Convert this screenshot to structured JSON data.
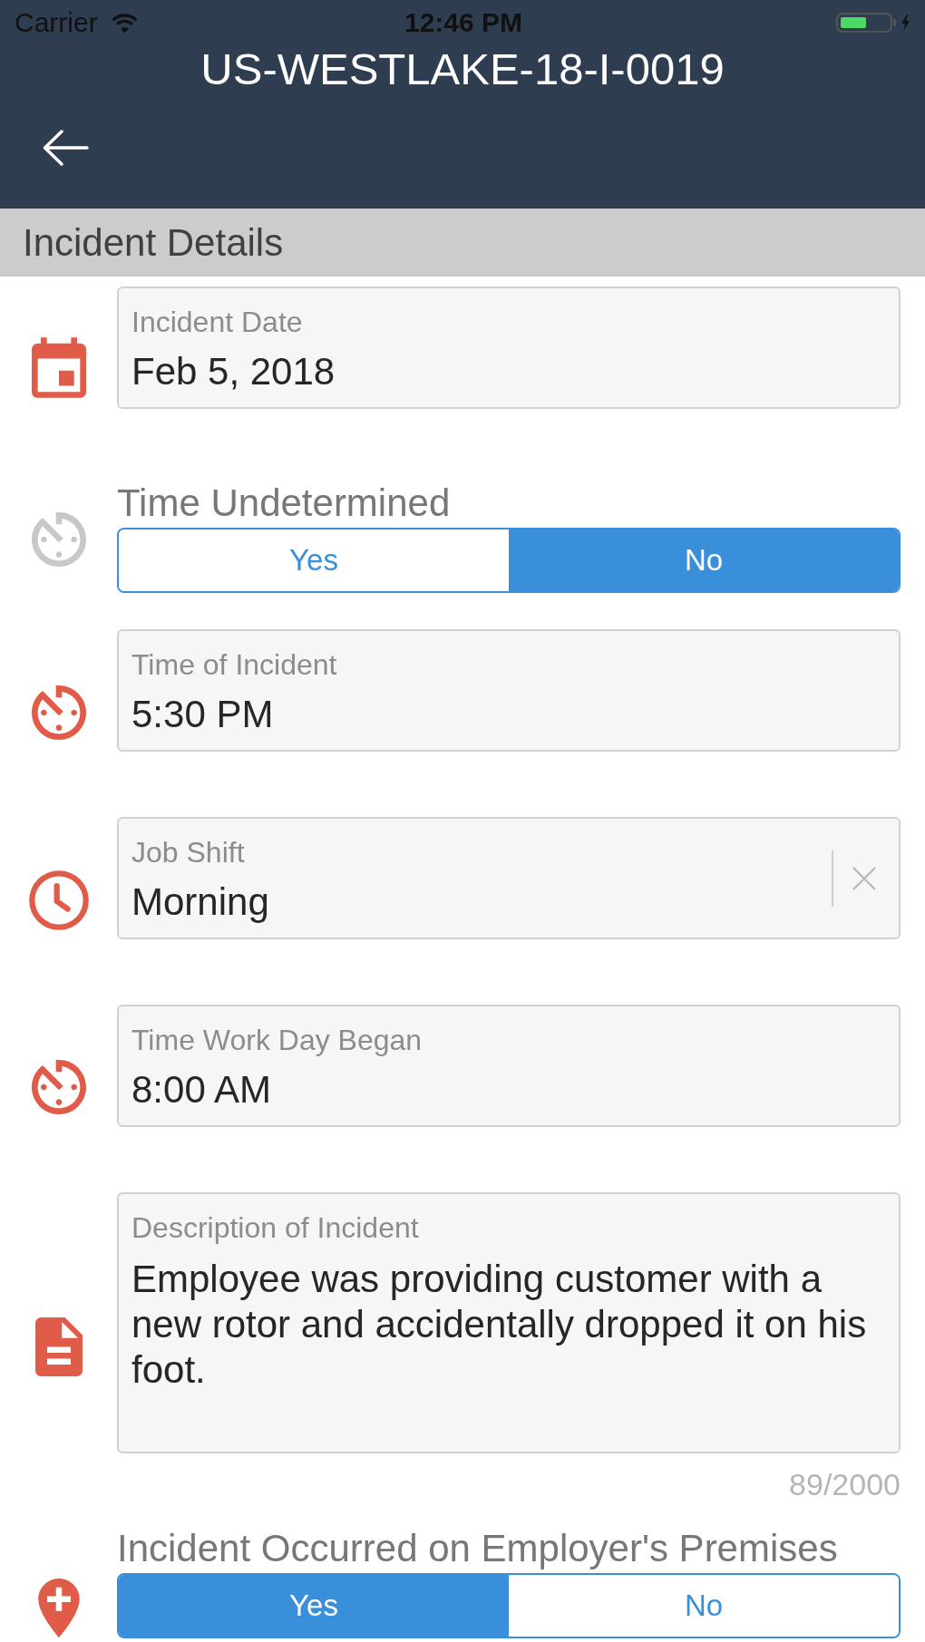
{
  "status_bar": {
    "carrier": "Carrier",
    "time": "12:46 PM"
  },
  "header": {
    "title": "US-WESTLAKE-18-I-0019"
  },
  "section": {
    "title": "Incident Details",
    "rows": [
      {
        "kind": "field",
        "color": "#e05c48",
        "label": "Incident Date",
        "value": "Feb 5, 2018",
        "clearable": false
      },
      {
        "kind": "toggle",
        "color": "#c8c8c8",
        "label": "Time Undetermined",
        "options": [
          {
            "label": "Yes",
            "selected": false
          },
          {
            "label": "No",
            "selected": true
          }
        ]
      },
      {
        "kind": "field",
        "color": "#e05c48",
        "label": "Time of Incident",
        "value": "5:30 PM",
        "clearable": false
      },
      {
        "kind": "field",
        "color": "#e05c48",
        "label": "Job Shift",
        "value": "Morning",
        "clearable": true
      },
      {
        "kind": "field",
        "color": "#e05c48",
        "label": "Time Work Day Began",
        "value": "8:00 AM",
        "clearable": false
      },
      {
        "kind": "textarea",
        "color": "#e05c48",
        "label": "Description of Incident",
        "value": "Employee was providing customer with a new rotor and accidentally dropped it on his foot.",
        "counter": "89/2000"
      },
      {
        "kind": "toggle",
        "color": "#e05c48",
        "label": "Incident Occurred on Employer's Premises",
        "options": [
          {
            "label": "Yes",
            "selected": true
          },
          {
            "label": "No",
            "selected": false
          }
        ]
      }
    ]
  }
}
